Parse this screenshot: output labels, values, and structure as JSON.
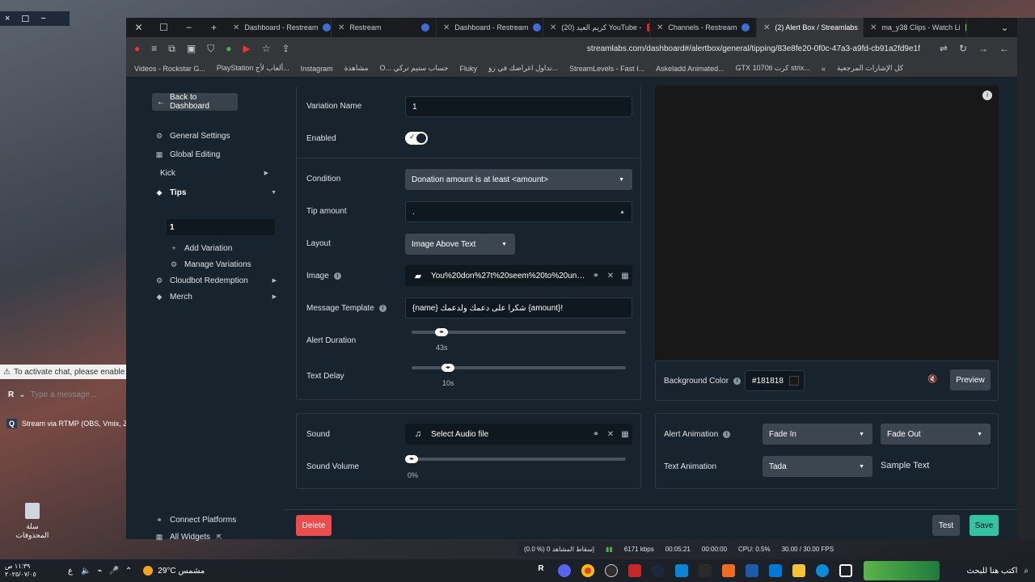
{
  "helper": {
    "icons": [
      "×",
      "☐",
      "−"
    ]
  },
  "chat": {
    "warning": "To activate chat, please enable",
    "placeholder": "Type a message...",
    "rtmp_item": "Stream via RTMP (OBS, Vmix, Z",
    "recycle_label": "سلة المحذوفات"
  },
  "tabs": [
    {
      "label": "Dashboard - Restream",
      "active": false
    },
    {
      "label": "Restream",
      "active": false
    },
    {
      "label": "Dashboard - Restream",
      "active": false
    },
    {
      "label": "كريم العيد (20) YouTube -",
      "active": false
    },
    {
      "label": "Channels - Restream",
      "active": false
    },
    {
      "label": "(2) Alert Box / Streamlabs",
      "active": true
    },
    {
      "label": "ma_y38 Clips - Watch Li",
      "active": false
    }
  ],
  "address": {
    "url": "streamlabs.com/dashboard#/alertbox/general/tipping/83e8fe20-0f0c-47a3-a9fd-cb91a2fd9e1f"
  },
  "bookmarks": [
    "كل الإشارات المرجعية",
    "GTX 1070ti كرت strix...",
    "Askeladd Animated...",
    "StreamLevels - Fast I...",
    "تداول اغراضك في رو...",
    "Fluky",
    "O... حساب ستيم تركي",
    "مشاهدة",
    "Instagram",
    "PlayStation ألعاب لأج...",
    "Videos - Rockstar G..."
  ],
  "sidebar": {
    "back": "Back to Dashboard",
    "items": [
      {
        "label": "General Settings",
        "icon": "gear-icon"
      },
      {
        "label": "Global Editing",
        "icon": "grid-icon"
      },
      {
        "label": "Kick",
        "icon": ""
      },
      {
        "label": "Tips",
        "icon": "tag-icon"
      },
      {
        "label": "1",
        "icon": ""
      },
      {
        "label": "Add Variation",
        "icon": "plus-icon"
      },
      {
        "label": "Manage Variations",
        "icon": "gear-icon"
      },
      {
        "label": "Cloudbot Redemption",
        "icon": "gear-icon"
      },
      {
        "label": "Merch",
        "icon": "tag-icon"
      }
    ],
    "bottom": [
      {
        "label": "Connect Platforms",
        "icon": "link-icon"
      },
      {
        "label": "All Widgets",
        "icon": "grid-icon"
      }
    ]
  },
  "form": {
    "variation_name_label": "Variation Name",
    "variation_name_value": "1",
    "enabled_label": "Enabled",
    "enabled": true,
    "condition_label": "Condition",
    "condition_value": "Donation amount is at least <amount>",
    "tip_amount_label": "Tip amount",
    "tip_amount_value": ".",
    "layout_label": "Layout",
    "layout_value": "Image Above Text",
    "image_label": "Image",
    "image_value": "You%20don%27t%20seem%20to%20under...",
    "message_label": "Message Template",
    "message_value": "{name} شكرا على دعمك ولدعمك {amount}!",
    "alert_duration_label": "Alert Duration",
    "alert_duration_value": "43s",
    "alert_duration_fraction": 0.14,
    "text_delay_label": "Text Delay",
    "text_delay_value": "10s",
    "text_delay_fraction": 0.17
  },
  "sound": {
    "sound_label": "Sound",
    "sound_value": "Select Audio file",
    "volume_label": "Sound Volume",
    "volume_value": "0%",
    "volume_fraction": 0
  },
  "preview": {
    "bg_label": "Background Color",
    "bg_value": "#181818",
    "preview_button": "Preview"
  },
  "animation": {
    "alert_label": "Alert Animation",
    "in_value": "Fade In",
    "out_value": "Fade Out",
    "text_label": "Text Animation",
    "text_value": "Tada",
    "sample": "Sample Text"
  },
  "footer": {
    "delete": "Delete",
    "test": "Test",
    "save": "Save"
  },
  "obs": {
    "stats": [
      "(0.0 %) 0 إسقاط المشاهد",
      "6171 kbps",
      "00:05:21",
      "00:00:00",
      "CPU: 0.5%",
      "30.00 / 30.00 FPS"
    ]
  },
  "taskbar": {
    "search_placeholder": "اكتب هنا للبحث",
    "weather": "29°C  مشمس",
    "time": "١١:٣٩ ص",
    "date": "٢٠٢٥/٠٧/٠٥"
  },
  "colors": {
    "accent_green": "#31c3a2",
    "delete_red": "#eb4c4c",
    "panel": "#17242d"
  }
}
